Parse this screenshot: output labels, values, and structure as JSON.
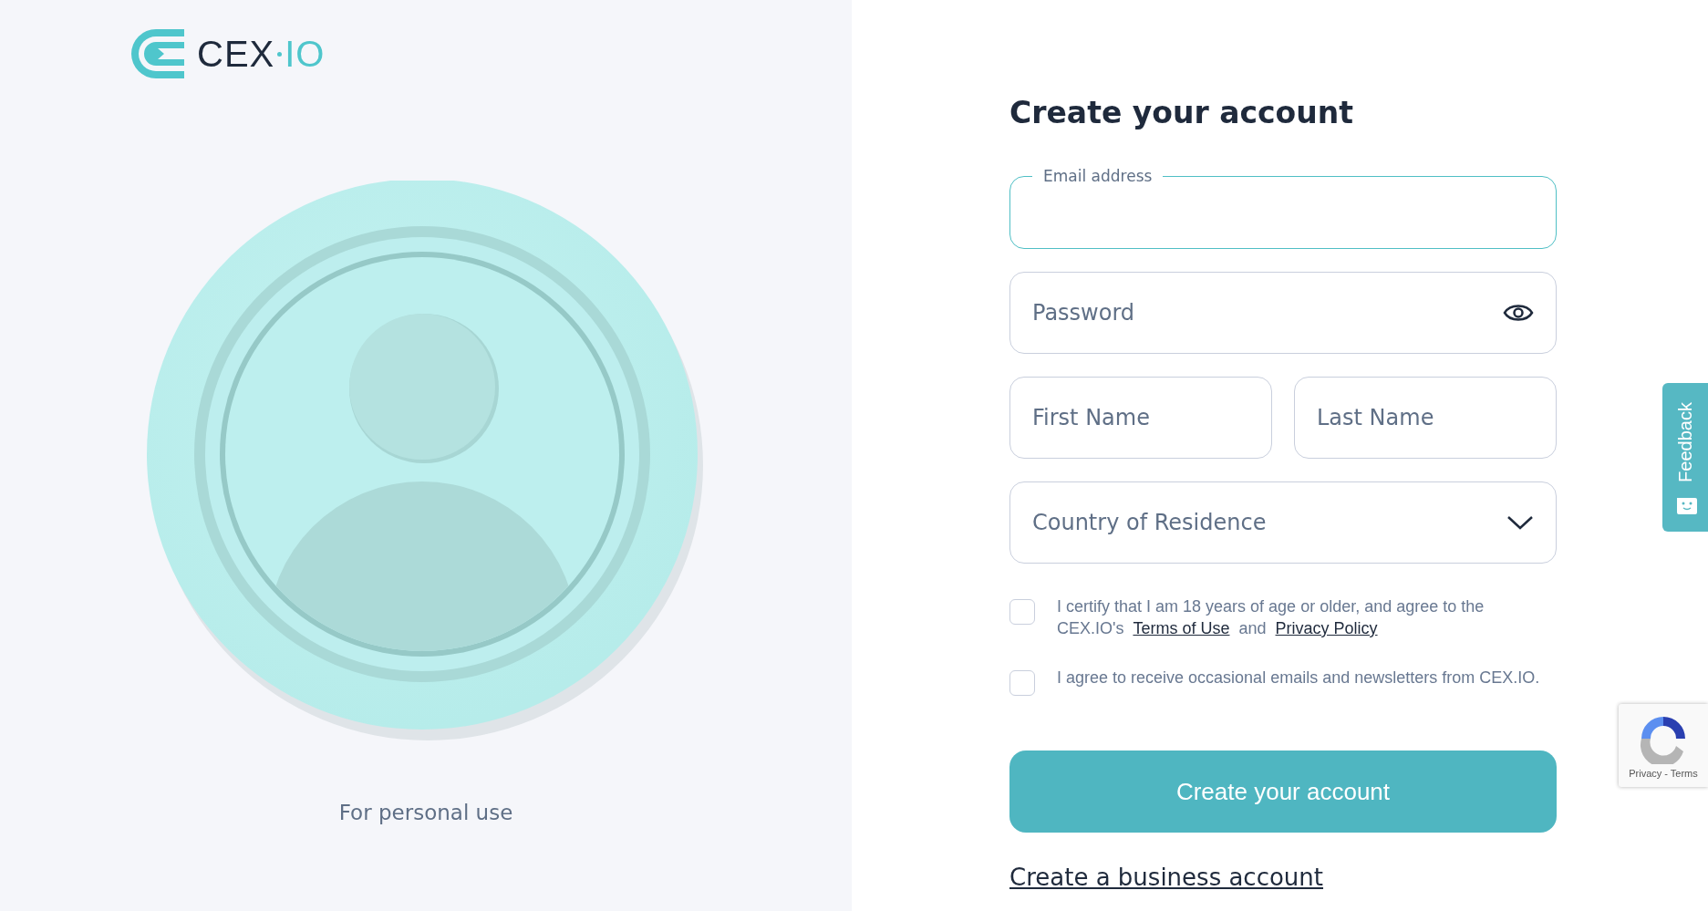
{
  "logo": {
    "primary": "CEX",
    "secondary": "IO"
  },
  "left_panel": {
    "caption": "For personal use"
  },
  "form": {
    "title": "Create your account",
    "rows": [
      [
        {
          "kind": "email",
          "label": "Email address",
          "focused": true
        }
      ],
      [
        {
          "kind": "password",
          "placeholder": "Password",
          "focused": false
        }
      ],
      [
        {
          "kind": "text",
          "placeholder": "First Name",
          "focused": false
        },
        {
          "kind": "text",
          "placeholder": "Last Name",
          "focused": false
        }
      ],
      [
        {
          "kind": "select",
          "placeholder": "Country of Residence",
          "focused": false
        }
      ]
    ],
    "consents": [
      {
        "checked": false,
        "parts": [
          {
            "kind": "text",
            "text": "I certify that I am 18 years of age or older, and agree to the CEX.IO's"
          },
          {
            "kind": "link",
            "text": "Terms of Use"
          },
          {
            "kind": "text",
            "text": "and"
          },
          {
            "kind": "link",
            "text": "Privacy Policy"
          }
        ]
      },
      {
        "checked": false,
        "parts": [
          {
            "kind": "text",
            "text": "I agree to receive occasional emails and newsletters from CEX.IO."
          }
        ]
      }
    ],
    "submit": "Create your account",
    "business_link": "Create a business account"
  },
  "feedback_tab": {
    "label": "Feedback"
  },
  "recaptcha": {
    "links": "Privacy - Terms"
  }
}
